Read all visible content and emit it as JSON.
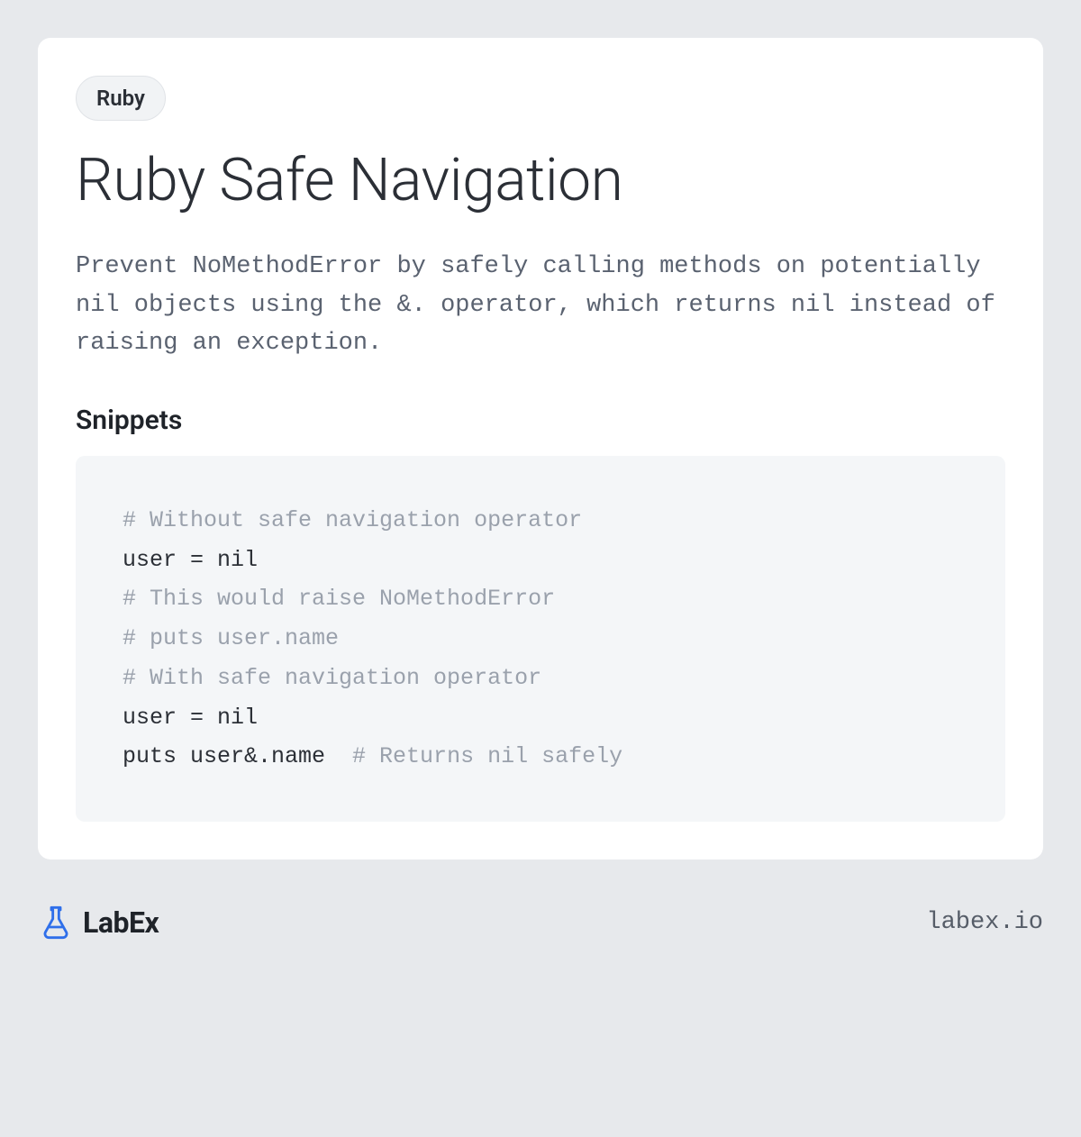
{
  "tag": "Ruby",
  "title": "Ruby Safe Navigation",
  "description": "Prevent NoMethodError by safely calling methods on potentially nil objects using the &. operator, which returns nil instead of raising an exception.",
  "snippets_heading": "Snippets",
  "code": {
    "l1_comment": "# Without safe navigation operator",
    "l2": "user = nil",
    "l3_comment": "# This would raise NoMethodError",
    "l4_comment": "# puts user.name",
    "l5": "",
    "l6_comment": "# With safe navigation operator",
    "l7": "user = nil",
    "l8_code": "puts user&.name  ",
    "l8_comment": "# Returns nil safely"
  },
  "brand": "LabEx",
  "site": "labex.io"
}
